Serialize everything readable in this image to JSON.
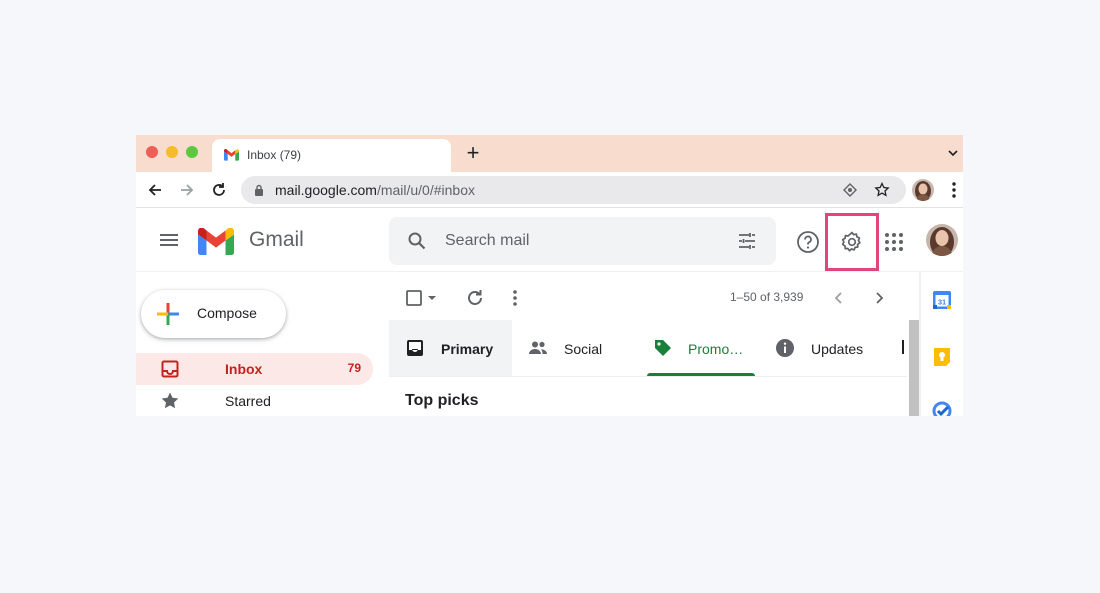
{
  "browser": {
    "tab_title": "Inbox (79)",
    "new_tab_symbol": "+",
    "url_host": "mail.google.com",
    "url_path": "/mail/u/0/#inbox"
  },
  "header": {
    "app_name": "Gmail",
    "search_placeholder": "Search mail",
    "highlight_color": "#e0467c"
  },
  "sidebar": {
    "compose_label": "Compose",
    "items": [
      {
        "label": "Inbox",
        "count": "79",
        "icon": "inbox-icon",
        "active": true
      },
      {
        "label": "Starred",
        "count": "",
        "icon": "star-icon",
        "active": false
      }
    ]
  },
  "toolbar": {
    "pagination": "1–50 of 3,939"
  },
  "tabs": [
    {
      "label": "Primary",
      "icon": "inbox-tray-icon"
    },
    {
      "label": "Social",
      "icon": "people-icon"
    },
    {
      "label": "Promo…",
      "icon": "tag-icon",
      "color": "#188038"
    },
    {
      "label": "Updates",
      "icon": "info-icon"
    }
  ],
  "content": {
    "section_title": "Top picks"
  },
  "side_panel": {
    "calendar_day": "31"
  }
}
